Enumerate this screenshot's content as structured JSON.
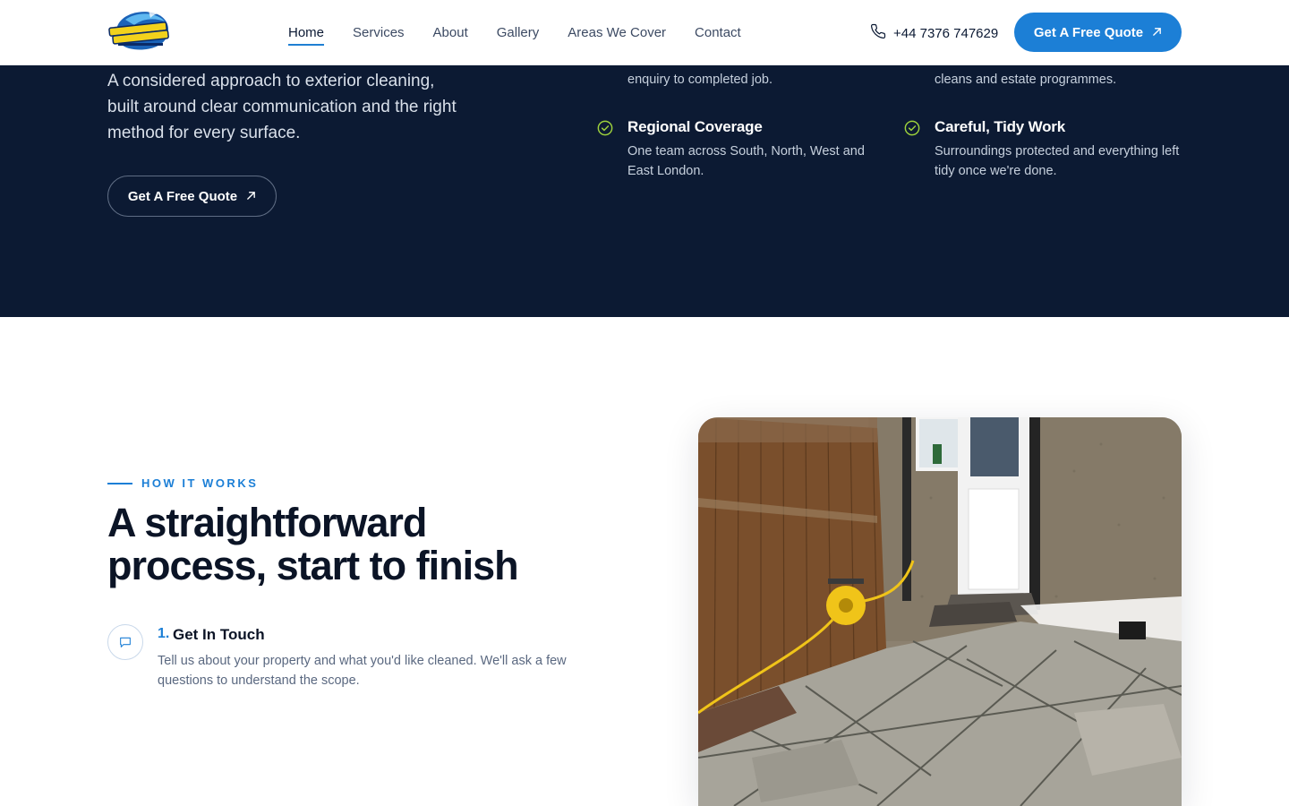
{
  "header": {
    "logo_alt": "Pushing Pressure",
    "nav": [
      {
        "label": "Home",
        "active": true
      },
      {
        "label": "Services",
        "active": false
      },
      {
        "label": "About",
        "active": false
      },
      {
        "label": "Gallery",
        "active": false
      },
      {
        "label": "Areas We Cover",
        "active": false
      },
      {
        "label": "Contact",
        "active": false
      }
    ],
    "phone": "+44 7376 747629",
    "phone_icon": "phone-icon",
    "cta_label": "Get A Free Quote",
    "cta_icon": "arrow-up-right-icon"
  },
  "hero": {
    "intro": "A considered approach to exterior cleaning, built around clear communication and the right method for every surface.",
    "cta_label": "Get A Free Quote",
    "fragment_left": "enquiry to completed job.",
    "fragment_right": "cleans and estate programmes.",
    "features": [
      {
        "title": "Regional Coverage",
        "desc": "One team across South, North, West and East London.",
        "icon": "check-circle-icon"
      },
      {
        "title": "Careful, Tidy Work",
        "desc": "Surroundings protected and everything left tidy once we're done.",
        "icon": "check-circle-icon"
      }
    ]
  },
  "how_it_works": {
    "eyebrow": "HOW IT WORKS",
    "heading_line1": "A straightforward",
    "heading_line2": "process, start to finish",
    "steps": [
      {
        "number": "1.",
        "title": "Get In Touch",
        "desc": "Tell us about your property and what you'd like cleaned. We'll ask a few questions to understand the scope.",
        "icon": "chat-icon"
      }
    ]
  },
  "colors": {
    "accent": "#1c7fd6",
    "dark_bg": "#0c1a33",
    "check": "#9ed23c"
  }
}
